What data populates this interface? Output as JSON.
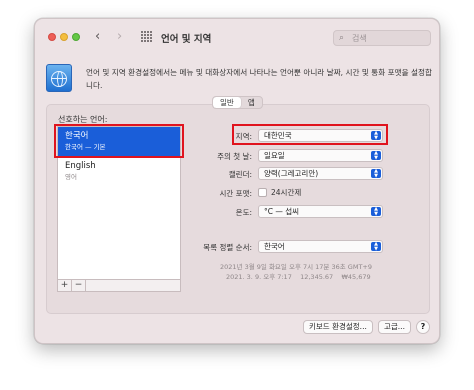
{
  "window": {
    "title": "언어 및 지역",
    "search_placeholder": "검색",
    "description": "언어 및 지역 환경설정에서는 메뉴 및 대화상자에서 나타나는 언어뿐 아니라 날짜, 시간 및 통화 포맷을 설정합니다."
  },
  "tabs": [
    {
      "label": "일반",
      "active": true
    },
    {
      "label": "앱",
      "active": false
    }
  ],
  "preferred_languages": {
    "label": "선호하는 언어:",
    "items": [
      {
        "name": "한국어",
        "sub": "한국어 — 기본",
        "selected": true
      },
      {
        "name": "English",
        "sub": "영어",
        "selected": false
      }
    ],
    "add_label": "+",
    "remove_label": "−"
  },
  "settings": {
    "region": {
      "label": "지역:",
      "value": "대한민국"
    },
    "first_day": {
      "label": "주의 첫 날:",
      "value": "일요일"
    },
    "calendar": {
      "label": "캘린더:",
      "value": "양력(그레고리안)"
    },
    "time_format": {
      "label": "시간 포맷:",
      "checkbox_label": "24시간제",
      "checked": false
    },
    "temperature": {
      "label": "온도:",
      "value": "°C — 섭씨"
    },
    "list_sort": {
      "label": "목록 정렬 순서:",
      "value": "한국어"
    }
  },
  "sample": {
    "line1": "2021년 3월 9일 화요일 오후 7시 17분 36초 GMT+9",
    "line2": "2021. 3. 9. 오후 7:17    12,345.67    ₩45,679"
  },
  "buttons": {
    "keyboard": "키보드 환경설정...",
    "advanced": "고급...",
    "help": "?"
  },
  "colors": {
    "accent": "#1a5ed9",
    "highlight_border": "#e0141e",
    "window_bg": "#ede3e5"
  }
}
